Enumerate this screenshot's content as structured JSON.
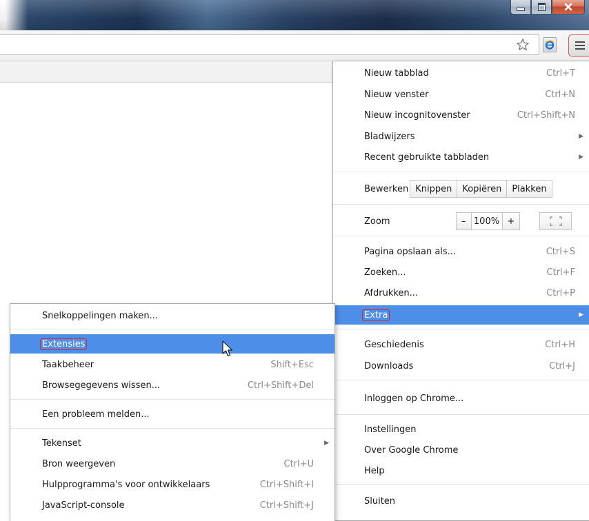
{
  "toolbar": {
    "icons": {
      "bookmark_star": "star-outline-icon",
      "extension": "ie-tab-icon",
      "menu": "hamburger-menu-icon"
    }
  },
  "chrome_menu": {
    "new_tab": {
      "label": "Nieuw tabblad",
      "shortcut": "Ctrl+T"
    },
    "new_window": {
      "label": "Nieuw venster",
      "shortcut": "Ctrl+N"
    },
    "new_incognito": {
      "label": "Nieuw incognitovenster",
      "shortcut": "Ctrl+Shift+N"
    },
    "bookmarks": {
      "label": "Bladwijzers"
    },
    "recent_tabs": {
      "label": "Recent gebruikte tabbladen"
    },
    "edit": {
      "label": "Bewerken",
      "cut": "Knippen",
      "copy": "Kopiëren",
      "paste": "Plakken"
    },
    "zoom": {
      "label": "Zoom",
      "minus": "–",
      "value": "100%",
      "plus": "+"
    },
    "save_page": {
      "label": "Pagina opslaan als...",
      "shortcut": "Ctrl+S"
    },
    "find": {
      "label": "Zoeken...",
      "shortcut": "Ctrl+F"
    },
    "print": {
      "label": "Afdrukken...",
      "shortcut": "Ctrl+P"
    },
    "tools": {
      "label": "Extra"
    },
    "history": {
      "label": "Geschiedenis",
      "shortcut": "Ctrl+H"
    },
    "downloads": {
      "label": "Downloads",
      "shortcut": "Ctrl+J"
    },
    "sign_in": {
      "label": "Inloggen op Chrome..."
    },
    "settings": {
      "label": "Instellingen"
    },
    "about": {
      "label": "Over Google Chrome"
    },
    "help": {
      "label": "Help"
    },
    "exit": {
      "label": "Sluiten"
    }
  },
  "tools_submenu": {
    "create_shortcuts": {
      "label": "Snelkoppelingen maken..."
    },
    "extensions": {
      "label": "Extensies"
    },
    "task_manager": {
      "label": "Taakbeheer",
      "shortcut": "Shift+Esc"
    },
    "clear_data": {
      "label": "Browsegegevens wissen...",
      "shortcut": "Ctrl+Shift+Del"
    },
    "report_issue": {
      "label": "Een probleem melden..."
    },
    "encoding": {
      "label": "Tekenset"
    },
    "view_source": {
      "label": "Bron weergeven",
      "shortcut": "Ctrl+U"
    },
    "dev_tools": {
      "label": "Hulpprogramma's voor ontwikkelaars",
      "shortcut": "Ctrl+Shift+I"
    },
    "js_console": {
      "label": "JavaScript-console",
      "shortcut": "Ctrl+Shift+J"
    }
  },
  "colors": {
    "highlight": "#4d8ee8",
    "annotation_box": "#d9263a"
  }
}
